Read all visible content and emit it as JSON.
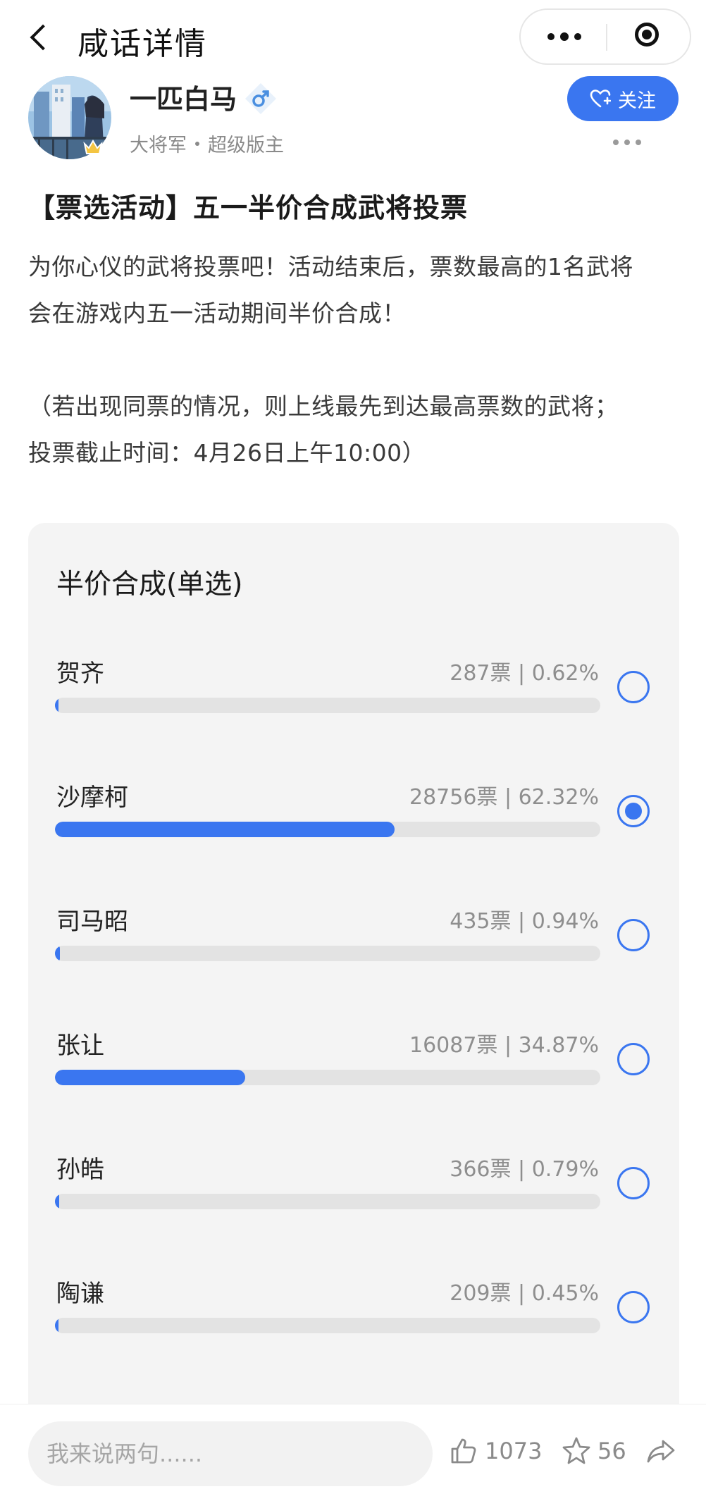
{
  "nav": {
    "title": "咸话详情"
  },
  "author": {
    "name": "一匹白马",
    "rank": "大将军",
    "role": "超级版主",
    "follow_label": "关注"
  },
  "post": {
    "title": "【票选活动】五一半价合成武将投票",
    "body_lines": [
      "为你心仪的武将投票吧！活动结束后，票数最高的1名武将",
      "会在游戏内五一活动期间半价合成！",
      "",
      "（若出现同票的情况，则上线最先到达最高票数的武将；",
      "投票截止时间：4月26日上午10:00）"
    ]
  },
  "poll": {
    "title": "半价合成(单选)",
    "options": [
      {
        "name": "贺齐",
        "stats": "287票 | 0.62%",
        "percent": 0.62,
        "selected": false
      },
      {
        "name": "沙摩柯",
        "stats": "28756票 | 62.32%",
        "percent": 62.32,
        "selected": true
      },
      {
        "name": "司马昭",
        "stats": "435票 | 0.94%",
        "percent": 0.94,
        "selected": false
      },
      {
        "name": "张让",
        "stats": "16087票 | 34.87%",
        "percent": 34.87,
        "selected": false
      },
      {
        "name": "孙皓",
        "stats": "366票 | 0.79%",
        "percent": 0.79,
        "selected": false
      },
      {
        "name": "陶谦",
        "stats": "209票 | 0.45%",
        "percent": 0.45,
        "selected": false
      }
    ]
  },
  "bottom": {
    "comment_placeholder": "我来说两句......",
    "likes": "1073",
    "favorites": "56"
  },
  "colors": {
    "accent": "#3a76f0",
    "track": "#e3e3e3",
    "card_bg": "#f4f4f4",
    "muted_text": "#8e8e8e"
  },
  "icons": {
    "back": "chevron-left-icon",
    "more": "more-dots-icon",
    "close": "target-close-icon",
    "gender": "male-icon",
    "follow": "heart-plus-icon",
    "like": "thumbs-up-icon",
    "favorite": "star-icon",
    "share": "share-arrow-icon"
  }
}
